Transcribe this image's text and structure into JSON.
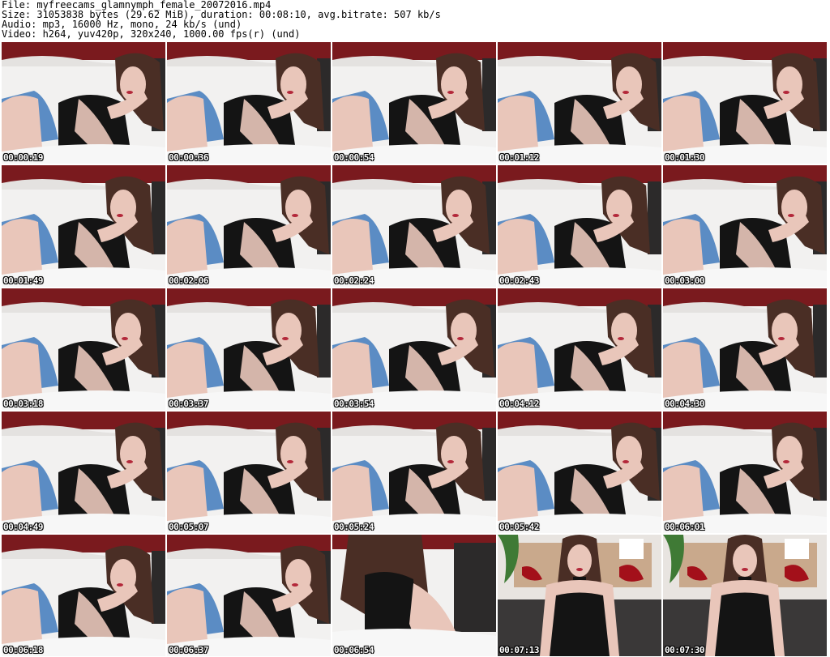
{
  "header": {
    "file": "File: myfreecams_glamnymph_female_20072016.mp4",
    "size": "Size: 31053838 bytes (29.62 MiB), duration: 00:08:10, avg.bitrate: 507 kb/s",
    "audio": "Audio: mp3, 16000 Hz, mono, 24 kb/s (und)",
    "video": "Video: h264, yuv420p, 320x240, 1000.00 fps(r) (und)"
  },
  "colors": {
    "wall_red": "#7a1a1e",
    "couch_white": "#f2f1f0",
    "skin": "#e9c6ba",
    "hair": "#4a2e25",
    "top_black": "#141414",
    "shorts_blue": "#5b8cc4",
    "bedding": "#f7f7f7"
  },
  "thumbnails": [
    {
      "time": "00:00:19",
      "scene": "couch"
    },
    {
      "time": "00:00:36",
      "scene": "couch"
    },
    {
      "time": "00:00:54",
      "scene": "couch"
    },
    {
      "time": "00:01:12",
      "scene": "couch"
    },
    {
      "time": "00:01:30",
      "scene": "couch"
    },
    {
      "time": "00:01:49",
      "scene": "couch"
    },
    {
      "time": "00:02:06",
      "scene": "couch"
    },
    {
      "time": "00:02:24",
      "scene": "couch"
    },
    {
      "time": "00:02:43",
      "scene": "couch"
    },
    {
      "time": "00:03:00",
      "scene": "couch"
    },
    {
      "time": "00:03:18",
      "scene": "couch"
    },
    {
      "time": "00:03:37",
      "scene": "couch"
    },
    {
      "time": "00:03:54",
      "scene": "couch"
    },
    {
      "time": "00:04:12",
      "scene": "couch"
    },
    {
      "time": "00:04:30",
      "scene": "couch"
    },
    {
      "time": "00:04:49",
      "scene": "couch"
    },
    {
      "time": "00:05:07",
      "scene": "couch"
    },
    {
      "time": "00:05:24",
      "scene": "couch"
    },
    {
      "time": "00:05:42",
      "scene": "couch"
    },
    {
      "time": "00:06:01",
      "scene": "couch"
    },
    {
      "time": "00:06:18",
      "scene": "couch"
    },
    {
      "time": "00:06:37",
      "scene": "couch"
    },
    {
      "time": "00:06:54",
      "scene": "closeup"
    },
    {
      "time": "00:07:13",
      "scene": "standing"
    },
    {
      "time": "00:07:30",
      "scene": "standing"
    }
  ]
}
